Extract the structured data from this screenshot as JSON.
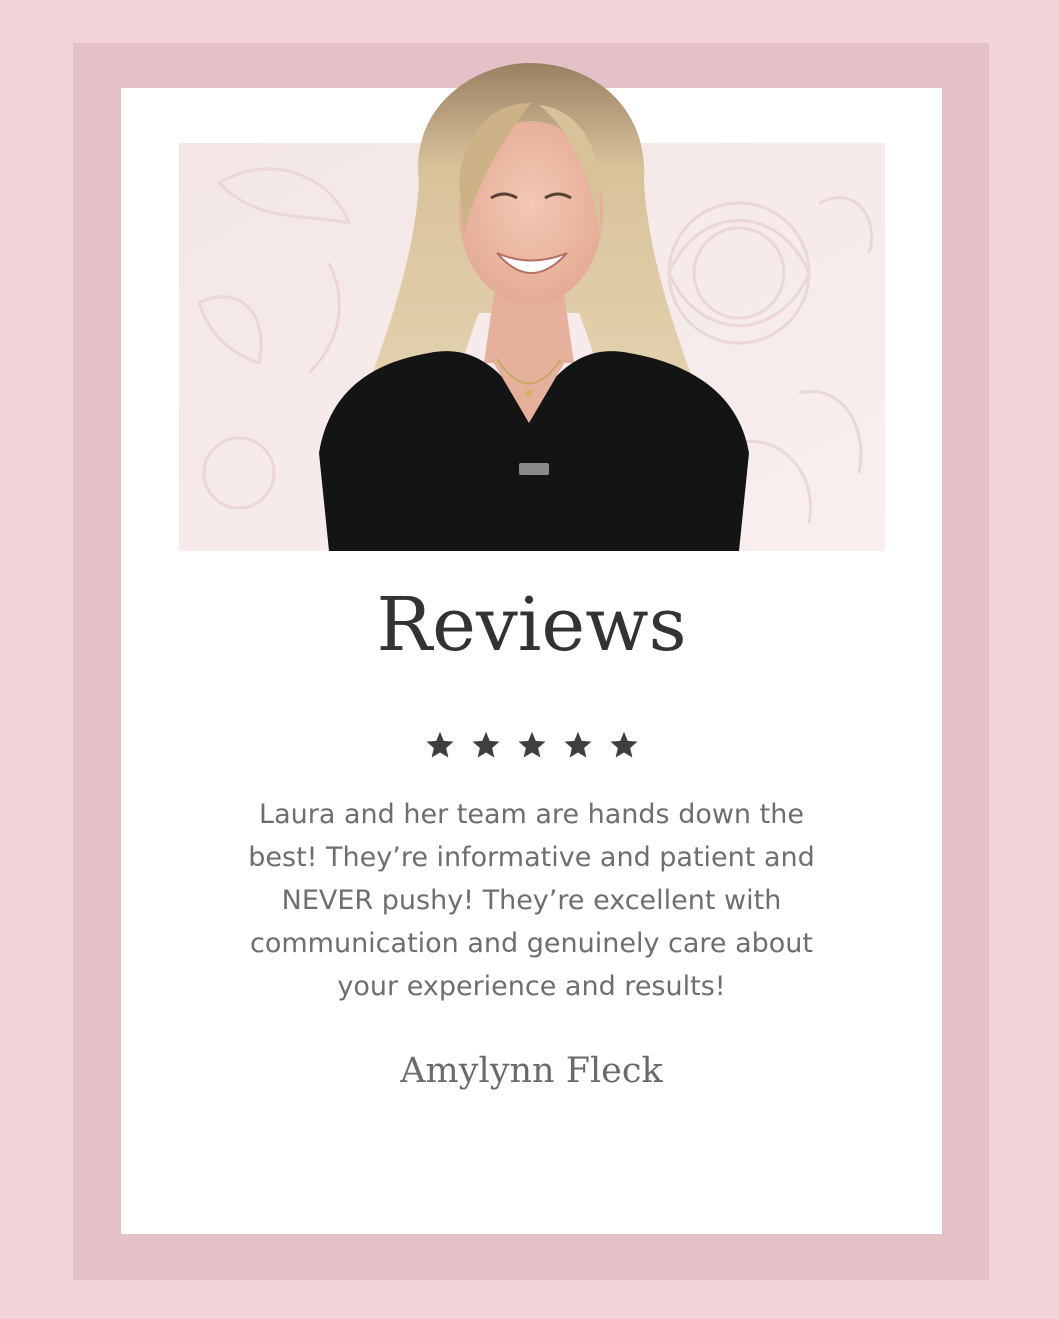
{
  "header": {
    "title": "Reviews"
  },
  "rating": {
    "stars": 5,
    "max": 5,
    "star_color": "#3f3f3f"
  },
  "review": {
    "text": "Laura and her team are hands down the\nbest! They’re informative and patient and\nNEVER pushy! They’re excellent with\ncommunication and genuinely care about\nyour experience and results!",
    "author": "Amylynn Fleck"
  },
  "colors": {
    "outer_background": "#f3d2d8",
    "frame": "#e4c1c6",
    "card": "#ffffff",
    "title_text": "#333333",
    "body_text": "#6e6e6e"
  },
  "image": {
    "subject": "portrait-of-smiling-blonde-woman-in-black-top",
    "background": "pale-pink-floral-pattern"
  }
}
